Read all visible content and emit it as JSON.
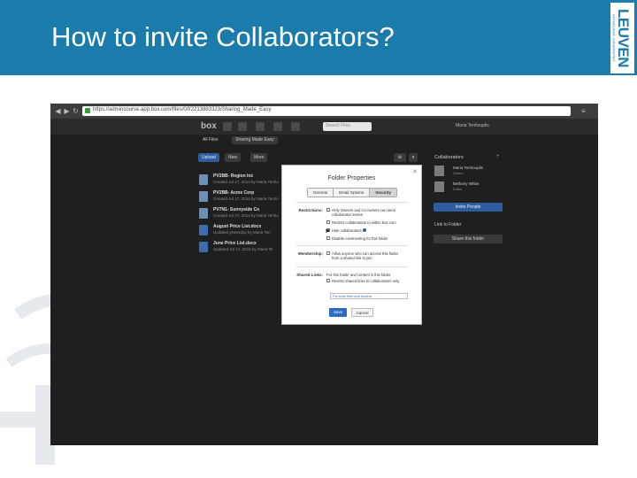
{
  "slide": {
    "title": "How to invite Collaborators?",
    "logo_text": "LEUVEN",
    "logo_subtext": "KATHOLIEKE UNIVERSITEIT",
    "colors": {
      "header": "#1b7cab",
      "background": "#ffffff"
    }
  },
  "browser": {
    "url": "https://admincourse.app.box.com/files/0/f/2213883323/Sharing_Made_Easy",
    "back_icon": "back-arrow-icon",
    "forward_icon": "forward-arrow-icon",
    "reload_icon": "reload-icon"
  },
  "app": {
    "logo": "box",
    "search_placeholder": "Search Files",
    "user_name": "Maria Tenhouplis",
    "breadcrumb": {
      "root": "All Files",
      "current": "Sharing Made Easy"
    },
    "toolbar": {
      "upload": "Upload",
      "new": "New",
      "more": "More"
    },
    "files": [
      {
        "name": "PV2BB- Region Inc",
        "meta": "Created Jul 17, 2014 by Maria Tenho"
      },
      {
        "name": "PV2BB- Acme Corp",
        "meta": "Created Jul 17, 2014 by Maria Tenho"
      },
      {
        "name": "PV7N1- Sunnyside Co",
        "meta": "Created Jul 17, 2014 by Maria Tenho"
      },
      {
        "name": "August Price List.docx",
        "meta": "Updated yesterday by Maria Ten"
      },
      {
        "name": "June Price List.docx",
        "meta": "Updated Jul 17, 2014 by Maria Te"
      }
    ],
    "sidebar": {
      "title": "Collaborators",
      "collaborators": [
        {
          "name": "Maria Tenhouplis",
          "role": "Owner"
        },
        {
          "name": "Bethany White",
          "role": "Editor"
        }
      ],
      "invite_label": "Invite People",
      "link_label": "Link to Folder",
      "share_label": "Share this folder"
    }
  },
  "modal": {
    "title": "Folder Properties",
    "tabs": [
      "General",
      "Email Options",
      "Security"
    ],
    "active_tab": "Security",
    "restrictions_label": "Restrictions:",
    "restrictions": [
      {
        "text": "Only Owners and Co-owners can send collaborator invites",
        "checked": false
      },
      {
        "text": "Restrict collaboration to within box.com",
        "checked": false
      },
      {
        "text": "Hide collaborators",
        "checked": true
      },
      {
        "text": "Disable commenting for this folder",
        "checked": false
      }
    ],
    "membership_label": "Membership:",
    "membership_option": "Allow anyone who can access this folder from a shared link to join",
    "shared_links_label": "Shared Links:",
    "shared_links_note": "For this folder and content in this folder",
    "shared_links_option": "Restrict shared links to collaborators only",
    "select_value": "For both files and folders",
    "save_label": "Save",
    "cancel_label": "Cancel"
  }
}
